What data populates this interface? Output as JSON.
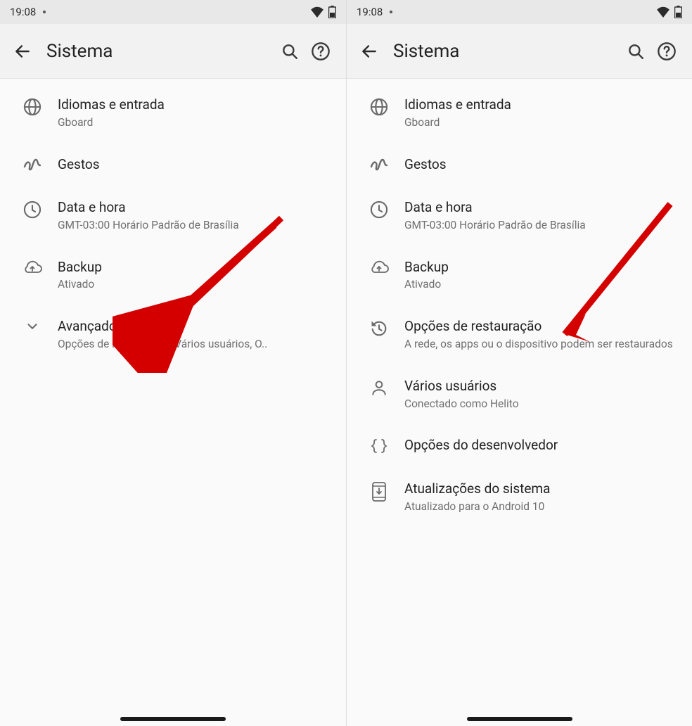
{
  "status": {
    "time": "19:08"
  },
  "appbar": {
    "title": "Sistema"
  },
  "screens": [
    {
      "items": [
        {
          "icon": "globe",
          "title": "Idiomas e entrada",
          "subtitle": "Gboard"
        },
        {
          "icon": "squiggle",
          "title": "Gestos",
          "subtitle": ""
        },
        {
          "icon": "clock",
          "title": "Data e hora",
          "subtitle": "GMT-03:00 Horário Padrão de Brasília"
        },
        {
          "icon": "cloud",
          "title": "Backup",
          "subtitle": "Ativado"
        },
        {
          "icon": "chevron",
          "title": "Avançado",
          "subtitle": "Opções de restauração, Vários usuários, O..",
          "ellipsis": true
        }
      ]
    },
    {
      "items": [
        {
          "icon": "globe",
          "title": "Idiomas e entrada",
          "subtitle": "Gboard"
        },
        {
          "icon": "squiggle",
          "title": "Gestos",
          "subtitle": ""
        },
        {
          "icon": "clock",
          "title": "Data e hora",
          "subtitle": "GMT-03:00 Horário Padrão de Brasília"
        },
        {
          "icon": "cloud",
          "title": "Backup",
          "subtitle": "Ativado"
        },
        {
          "icon": "history",
          "title": "Opções de restauração",
          "subtitle": "A rede, os apps ou o dispositivo podem ser restaurados"
        },
        {
          "icon": "user",
          "title": "Vários usuários",
          "subtitle": "Conectado como Helito"
        },
        {
          "icon": "braces",
          "title": "Opções do desenvolvedor",
          "subtitle": ""
        },
        {
          "icon": "update",
          "title": "Atualizações do sistema",
          "subtitle": "Atualizado para o Android 10"
        }
      ]
    }
  ]
}
